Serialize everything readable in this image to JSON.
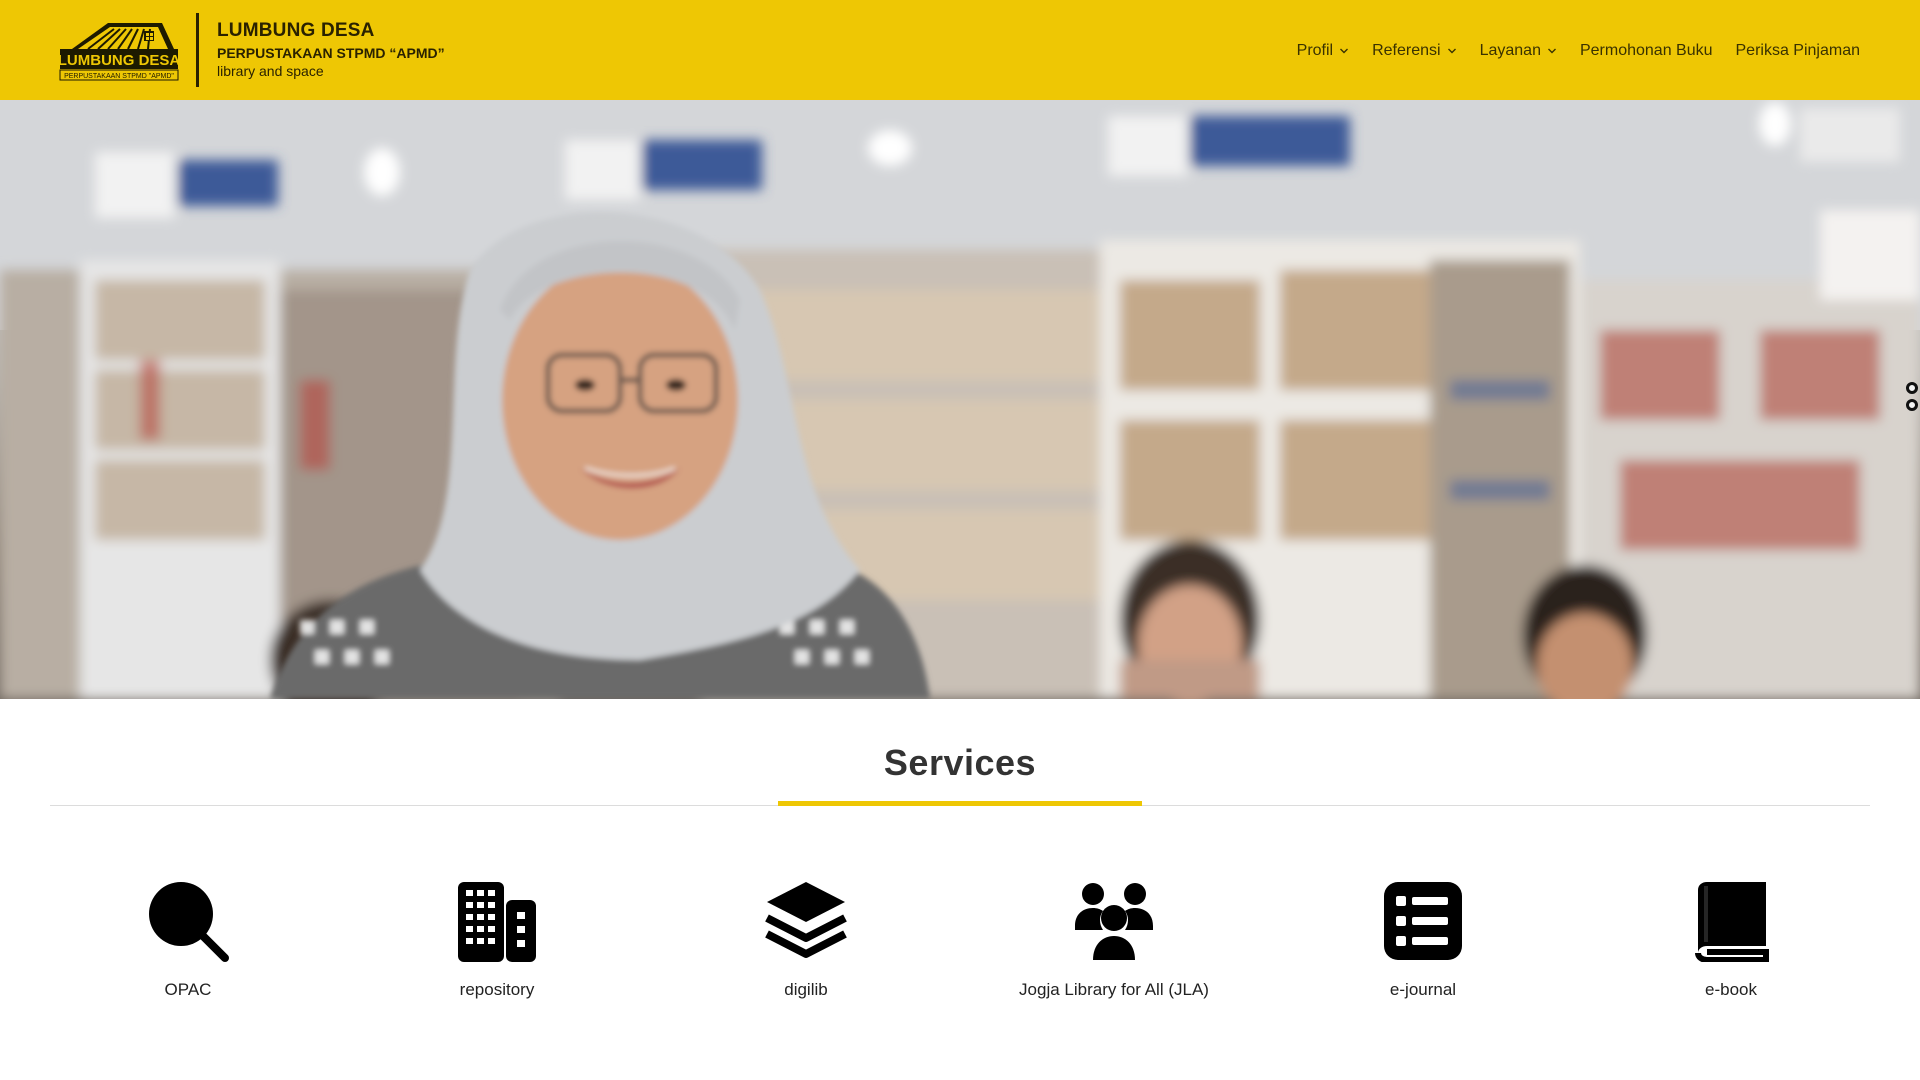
{
  "header": {
    "logo_text": "LUMBUNG DESA",
    "logo_subtext": "PERPUSTAKAAN STPMD \"APMD\"",
    "title": "LUMBUNG DESA",
    "subtitle": "PERPUSTAKAAN STPMD “APMD”",
    "tagline": "library and space",
    "accent_color": "#eec704"
  },
  "nav": {
    "items": [
      {
        "label": "Profil",
        "has_dropdown": true,
        "icon": "chevron-down-icon"
      },
      {
        "label": "Referensi",
        "has_dropdown": true,
        "icon": "chevron-down-icon"
      },
      {
        "label": "Layanan",
        "has_dropdown": true,
        "icon": "chevron-down-icon"
      },
      {
        "label": "Permohonan Buku",
        "has_dropdown": false
      },
      {
        "label": "Periksa Pinjaman",
        "has_dropdown": false
      }
    ]
  },
  "hero": {
    "image": "library-photo"
  },
  "services": {
    "title": "Services",
    "items": [
      {
        "label": "OPAC",
        "icon": "search-icon"
      },
      {
        "label": "repository",
        "icon": "building-icon"
      },
      {
        "label": "digilib",
        "icon": "layers-icon"
      },
      {
        "label": "Jogja Library for All (JLA)",
        "icon": "users-icon"
      },
      {
        "label": "e-journal",
        "icon": "list-icon"
      },
      {
        "label": "e-book",
        "icon": "book-icon"
      }
    ]
  }
}
